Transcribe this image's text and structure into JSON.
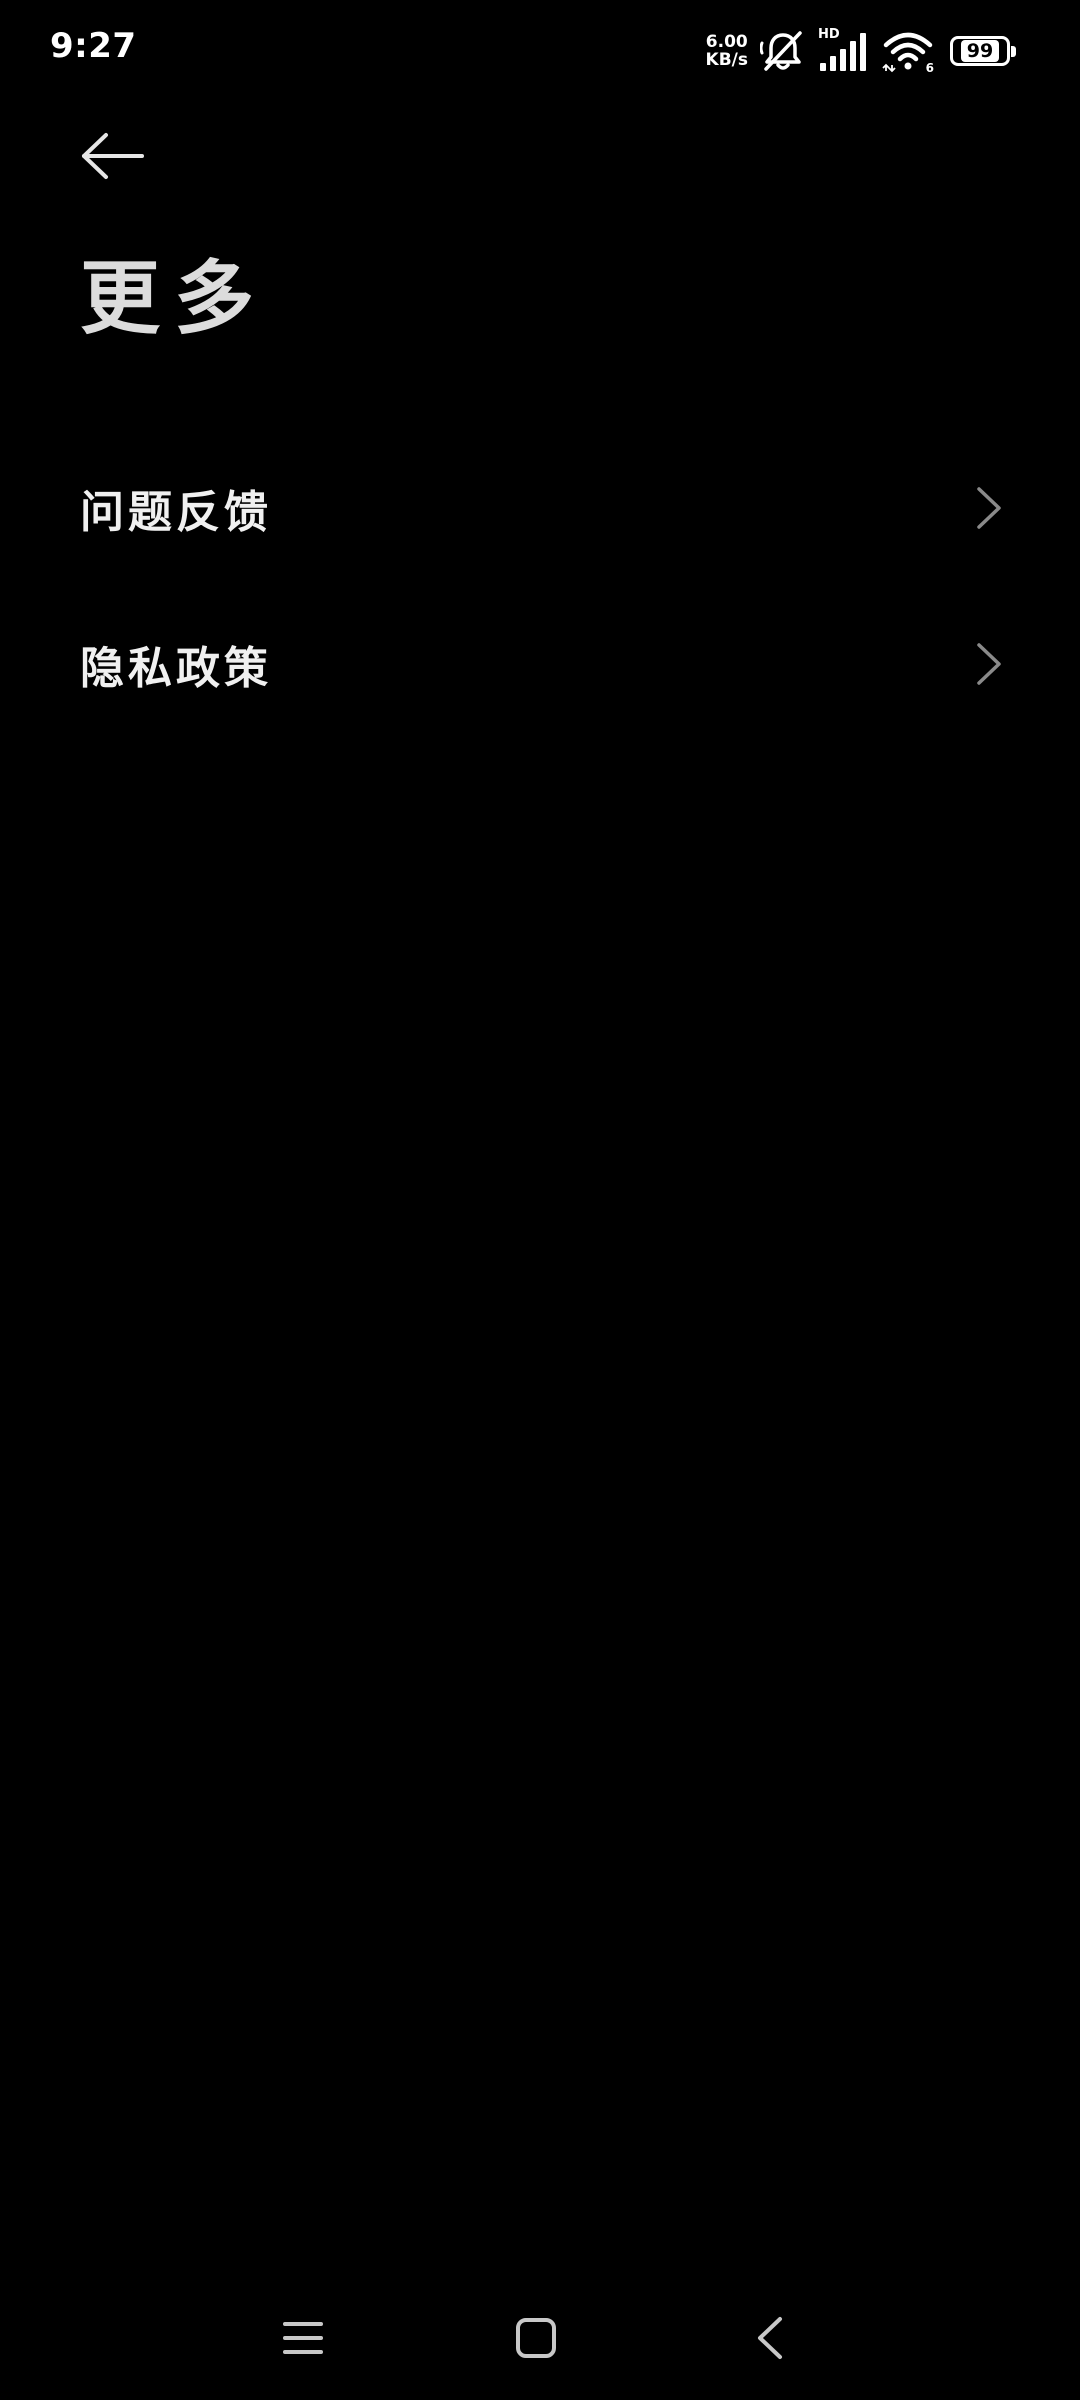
{
  "status_bar": {
    "time": "9:27",
    "net_speed_value": "6.00",
    "net_speed_unit": "KB/s",
    "signal_label": "HD",
    "wifi_label": "6",
    "battery_level": "99"
  },
  "header": {
    "title": "更多"
  },
  "menu": {
    "items": [
      {
        "label": "问题反馈"
      },
      {
        "label": "隐私政策"
      }
    ]
  },
  "colors": {
    "background": "#000000",
    "text": "#f0f0f0",
    "chevron": "#8a8a8a"
  }
}
